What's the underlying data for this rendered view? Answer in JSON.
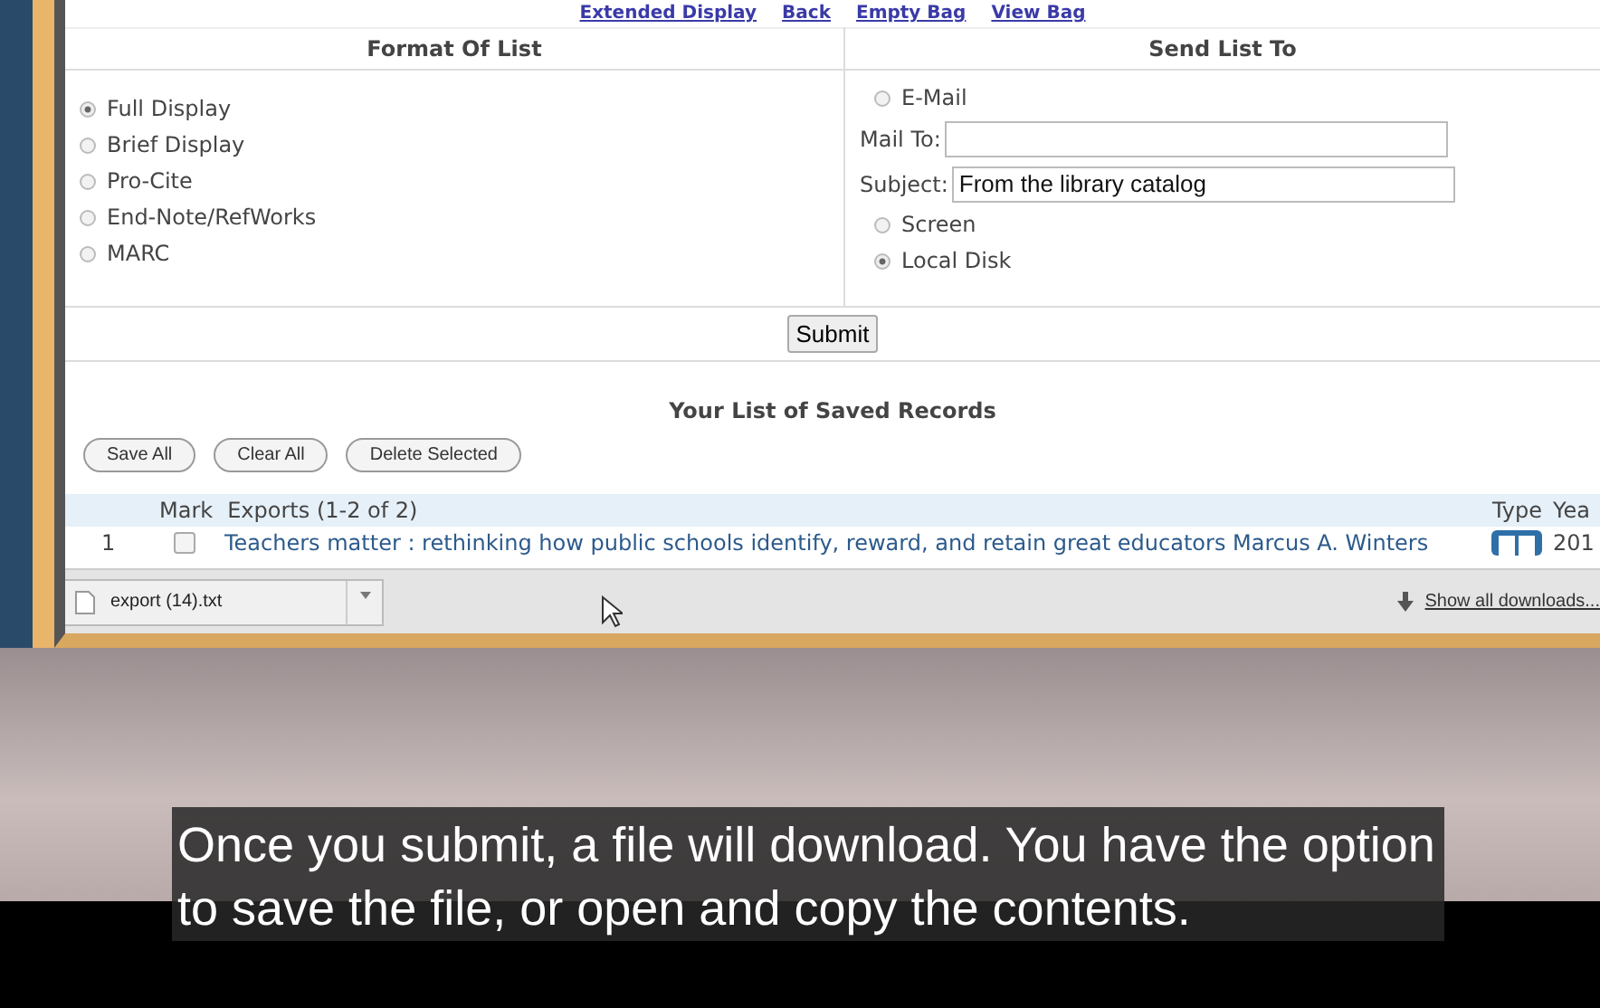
{
  "top_links": [
    "Extended Display",
    "Back",
    "Empty Bag",
    "View Bag"
  ],
  "format_panel": {
    "title": "Format Of List",
    "options": [
      {
        "label": "Full Display",
        "selected": true
      },
      {
        "label": "Brief Display",
        "selected": false
      },
      {
        "label": "Pro-Cite",
        "selected": false
      },
      {
        "label": "End-Note/RefWorks",
        "selected": false
      },
      {
        "label": "MARC",
        "selected": false
      }
    ]
  },
  "send_panel": {
    "title": "Send List To",
    "email": {
      "label": "E-Mail",
      "selected": false
    },
    "mail_to": {
      "label": "Mail To:"
    },
    "subject": {
      "label": "Subject:",
      "value": "From the library catalog"
    },
    "destinations": [
      {
        "label": "Screen",
        "selected": false
      },
      {
        "label": "Local Disk",
        "selected": true
      }
    ]
  },
  "submit": "Submit",
  "saved_records": {
    "title": "Your List of Saved Records",
    "buttons": [
      "Save All",
      "Clear All",
      "Delete Selected"
    ],
    "columns": {
      "mark": "Mark",
      "exports": "Exports (1-2 of 2)",
      "type": "Type",
      "year": "Yea"
    },
    "rows": [
      {
        "number": "1",
        "checked": false,
        "title": "Teachers matter : rethinking how public schools identify, reward, and retain great educators Marcus A. Winters",
        "year": "201"
      }
    ]
  },
  "download_bar": {
    "file": "export (14).txt",
    "show_all": "Show all downloads..."
  },
  "caption": "Once you submit, a file will download. You have the option to save the file, or open and copy the contents."
}
